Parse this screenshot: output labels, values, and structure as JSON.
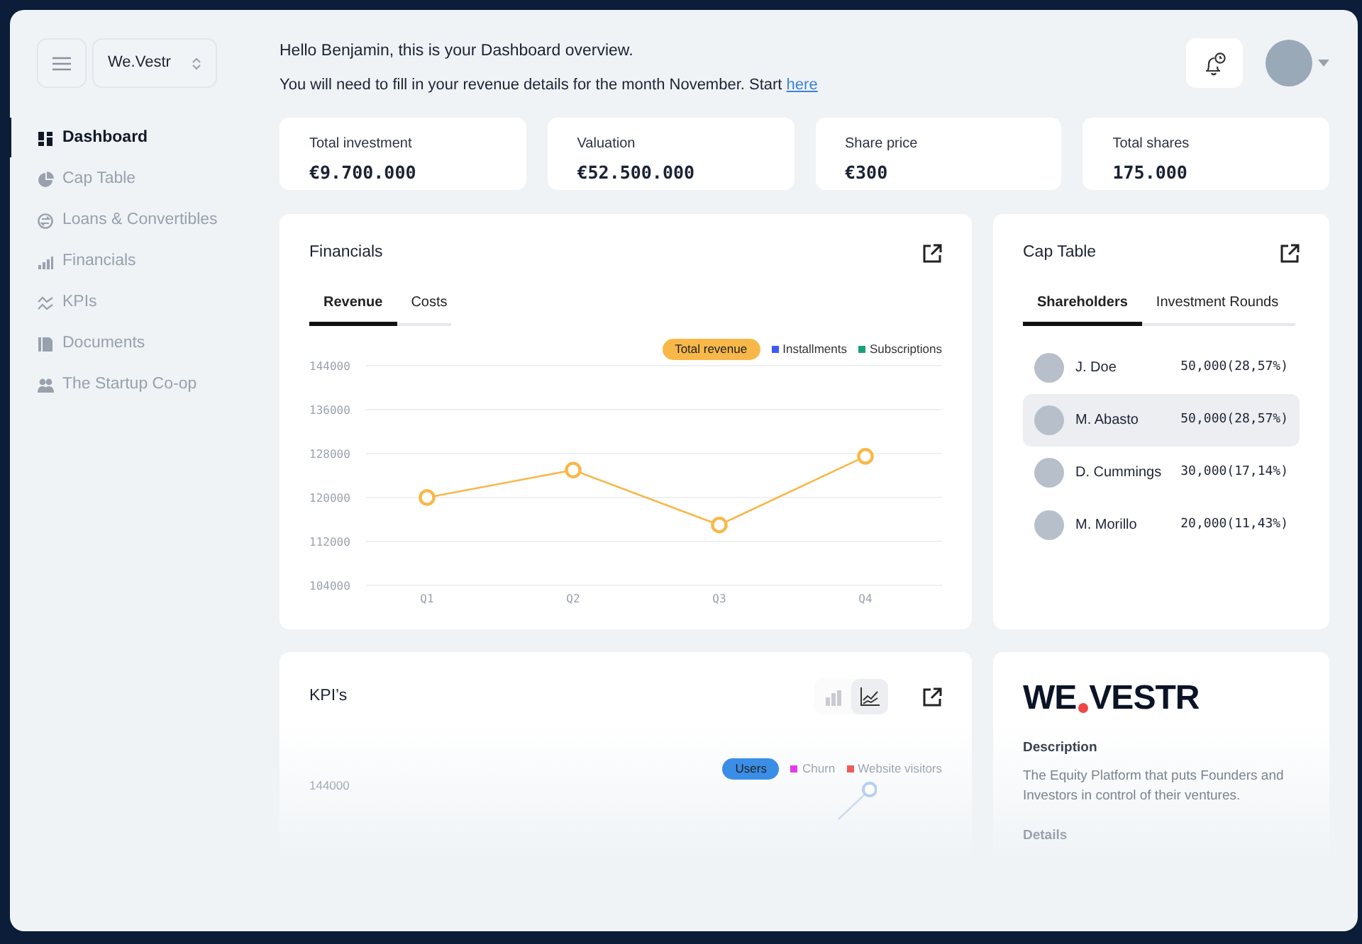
{
  "sidebar": {
    "company_selector": {
      "value": "We.Vestr"
    },
    "items": [
      {
        "label": "Dashboard",
        "kind": "grid",
        "selected": true
      },
      {
        "label": "Cap Table",
        "kind": "pie",
        "selected": false
      },
      {
        "label": "Loans & Convertibles",
        "kind": "loop",
        "selected": false
      },
      {
        "label": "Financials",
        "kind": "bars",
        "selected": false
      },
      {
        "label": "KPIs",
        "kind": "zigzag",
        "selected": false
      },
      {
        "label": "Documents",
        "kind": "document",
        "selected": false
      },
      {
        "label": "The Startup Co-op",
        "kind": "people",
        "selected": false
      }
    ]
  },
  "header": {
    "greeting": "Hello Benjamin, this is your Dashboard overview.",
    "notice": "You will need to fill in your revenue details for the month November. Start",
    "notice_link": "here"
  },
  "stats": [
    {
      "label": "Total investment",
      "value": "€9.700.000"
    },
    {
      "label": "Valuation",
      "value": "€52.500.000"
    },
    {
      "label": "Share price",
      "value": "€300"
    },
    {
      "label": "Total shares",
      "value": "175.000"
    }
  ],
  "financials": {
    "title": "Financials",
    "tabs": [
      {
        "label": "Revenue",
        "selected": true
      },
      {
        "label": "Costs",
        "selected": false
      }
    ],
    "legend": [
      {
        "label": "Installments",
        "color": "#3b5bff",
        "selected": false
      },
      {
        "label": "Subscriptions",
        "color": "#1aa179",
        "selected": false
      }
    ],
    "chart_data": {
      "type": "line",
      "categories": [
        "Q1",
        "Q2",
        "Q3",
        "Q4"
      ],
      "series": [
        {
          "name": "Total revenue",
          "color": "#f8b849",
          "marker": "circle",
          "values": [
            120000,
            125000,
            115000,
            127500
          ]
        }
      ],
      "grid": true,
      "ylim": [
        104000,
        144000
      ],
      "yticks": [
        104000,
        112000,
        120000,
        128000,
        136000,
        144000
      ]
    }
  },
  "cap_table": {
    "title": "Cap Table",
    "tabs": [
      {
        "label": "Shareholders",
        "selected": true
      },
      {
        "label": "Investment Rounds",
        "selected": false
      }
    ],
    "rows": [
      {
        "name": "J. Doe",
        "shares": "50,000(28,57%)",
        "selected": false
      },
      {
        "name": "M. Abasto",
        "shares": "50,000(28,57%)",
        "selected": true
      },
      {
        "name": "D. Cummings",
        "shares": "30,000(17,14%)",
        "selected": false
      },
      {
        "name": "M. Morillo",
        "shares": "20,000(11,43%)",
        "selected": false
      }
    ]
  },
  "kpis": {
    "title": "KPI’s",
    "view_toggle": [
      {
        "kind": "bar",
        "selected": false
      },
      {
        "kind": "line",
        "selected": true
      }
    ],
    "legend": [
      {
        "label": "Users",
        "color": "#3a8ee6",
        "selected": true
      },
      {
        "label": "Churn",
        "color": "#e23be8",
        "selected": false
      },
      {
        "label": "Website visitors",
        "color": "#f05a5a",
        "selected": false
      }
    ],
    "axis_label": "144000"
  },
  "company": {
    "logo_parts": [
      "WE",
      "VESTR"
    ],
    "description_heading": "Description",
    "description": "The Equity Platform that puts Founders and Investors in control of their ventures.",
    "details_heading": "Details"
  }
}
